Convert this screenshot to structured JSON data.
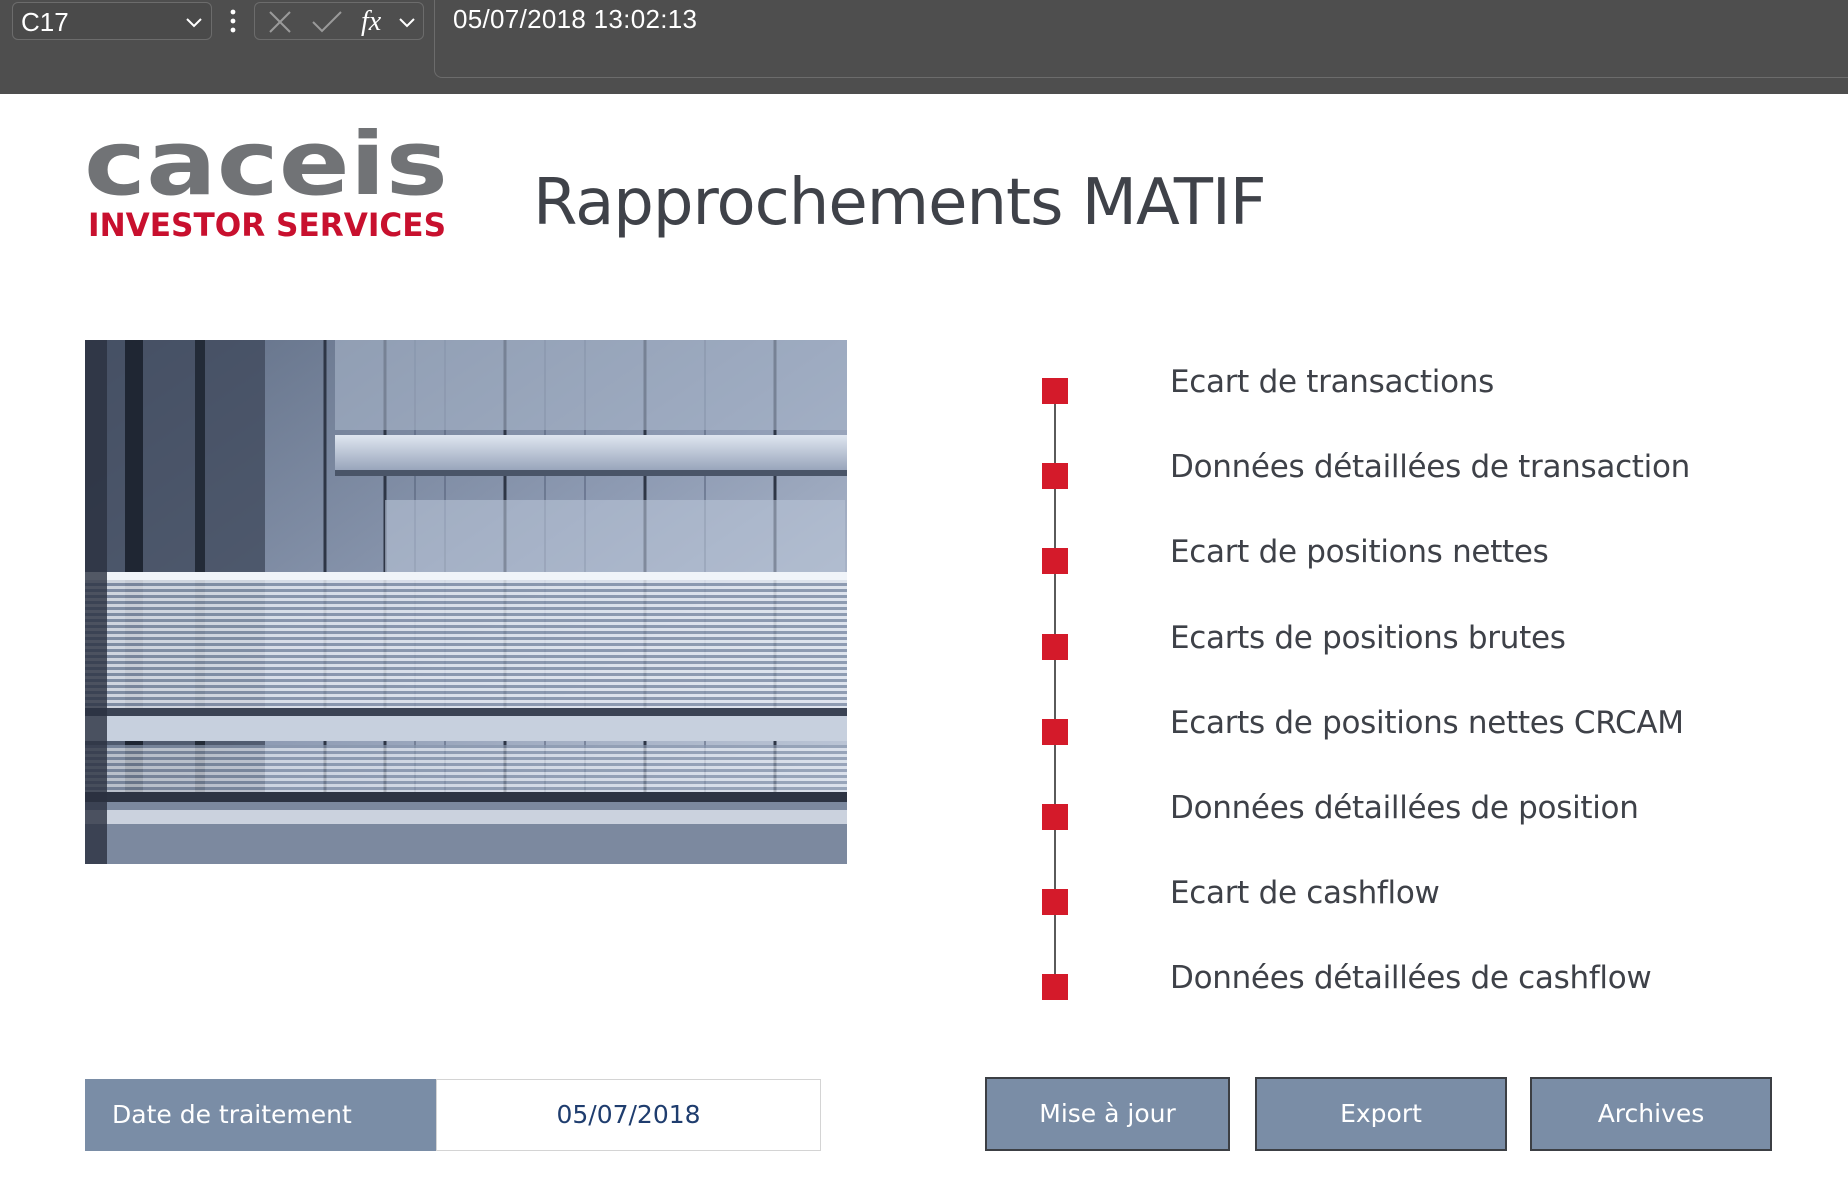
{
  "formula_bar": {
    "cell_reference": "C17",
    "formula_value": "05/07/2018 13:02:13",
    "icons": [
      "chevron-down-icon",
      "more-vertical-icon",
      "cancel-x-icon",
      "confirm-check-icon",
      "fx-function-icon"
    ]
  },
  "header": {
    "logo_wordmark": "caceis",
    "logo_tagline": "INVESTOR SERVICES",
    "title": "Rapprochements MATIF"
  },
  "menu": {
    "items": [
      {
        "label": "Ecart de transactions"
      },
      {
        "label": "Données détaillées de transaction"
      },
      {
        "label": "Ecart de positions nettes"
      },
      {
        "label": "Ecarts de positions brutes"
      },
      {
        "label": "Ecarts de positions nettes CRCAM"
      },
      {
        "label": "Données détaillées de position"
      },
      {
        "label": "Ecart de cashflow"
      },
      {
        "label": "Données détaillées de cashflow"
      }
    ]
  },
  "footer": {
    "date_label": "Date de traitement",
    "date_value": "05/07/2018",
    "buttons": {
      "update": "Mise à jour",
      "export": "Export",
      "archives": "Archives"
    }
  },
  "colors": {
    "formula_bar_bg": "#4e4e4e",
    "accent_red": "#d41a2a",
    "button_blue_grey": "#7a8da6",
    "title_text": "#3f4249",
    "date_value_text": "#1f3d6e"
  }
}
